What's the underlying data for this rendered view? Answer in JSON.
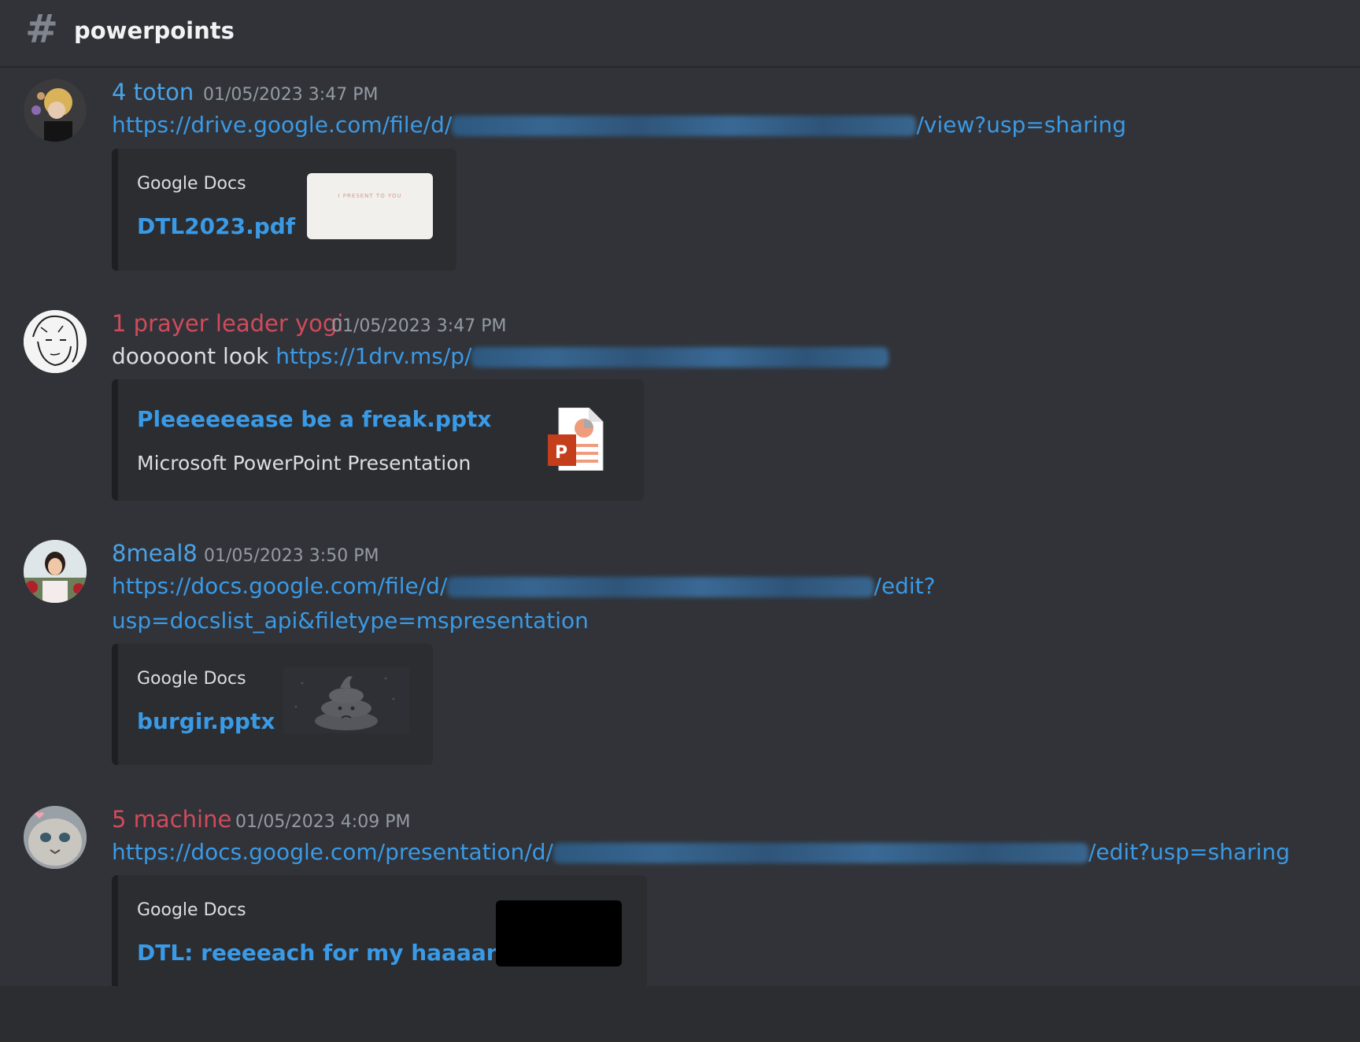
{
  "channel": {
    "name": "powerpoints",
    "icon": "hash-icon"
  },
  "messages": [
    {
      "username": "4 toton",
      "name_color": "#4aa3e8",
      "timestamp": "01/05/2023 3:47 PM",
      "link_prefix": "https://drive.google.com/file/d/",
      "link_suffix": "/view?usp=sharing",
      "embed": {
        "provider": "Google Docs",
        "title": "DTL2023.pdf",
        "thumb_text": "I PRESENT TO YOU"
      }
    },
    {
      "username": "1 prayer leader yogi",
      "name_color": "#d04b5c",
      "timestamp": "01/05/2023 3:47 PM",
      "text": "dooooont look",
      "link_prefix": "https://1drv.ms/p/",
      "embed": {
        "title": "Pleeeeeease be a freak.pptx",
        "description": "Microsoft PowerPoint Presentation",
        "icon": "powerpoint-file-icon"
      }
    },
    {
      "username": "8meal8",
      "name_color": "#4aa3e8",
      "timestamp": "01/05/2023 3:50 PM",
      "link_prefix": "https://docs.google.com/file/d/",
      "link_suffix": "/edit?",
      "link_line2": "usp=docslist_api&filetype=mspresentation",
      "embed": {
        "provider": "Google Docs",
        "title": "burgir.pptx",
        "thumb_icon": "poop-icon"
      }
    },
    {
      "username": "5 machine",
      "name_color": "#d04b5c",
      "timestamp": "01/05/2023 4:09 PM",
      "link_prefix": "https://docs.google.com/presentation/d/",
      "link_suffix": "/edit?usp=sharing",
      "embed": {
        "provider": "Google Docs",
        "title": "DTL: reeeeach for my haaaand"
      }
    }
  ]
}
